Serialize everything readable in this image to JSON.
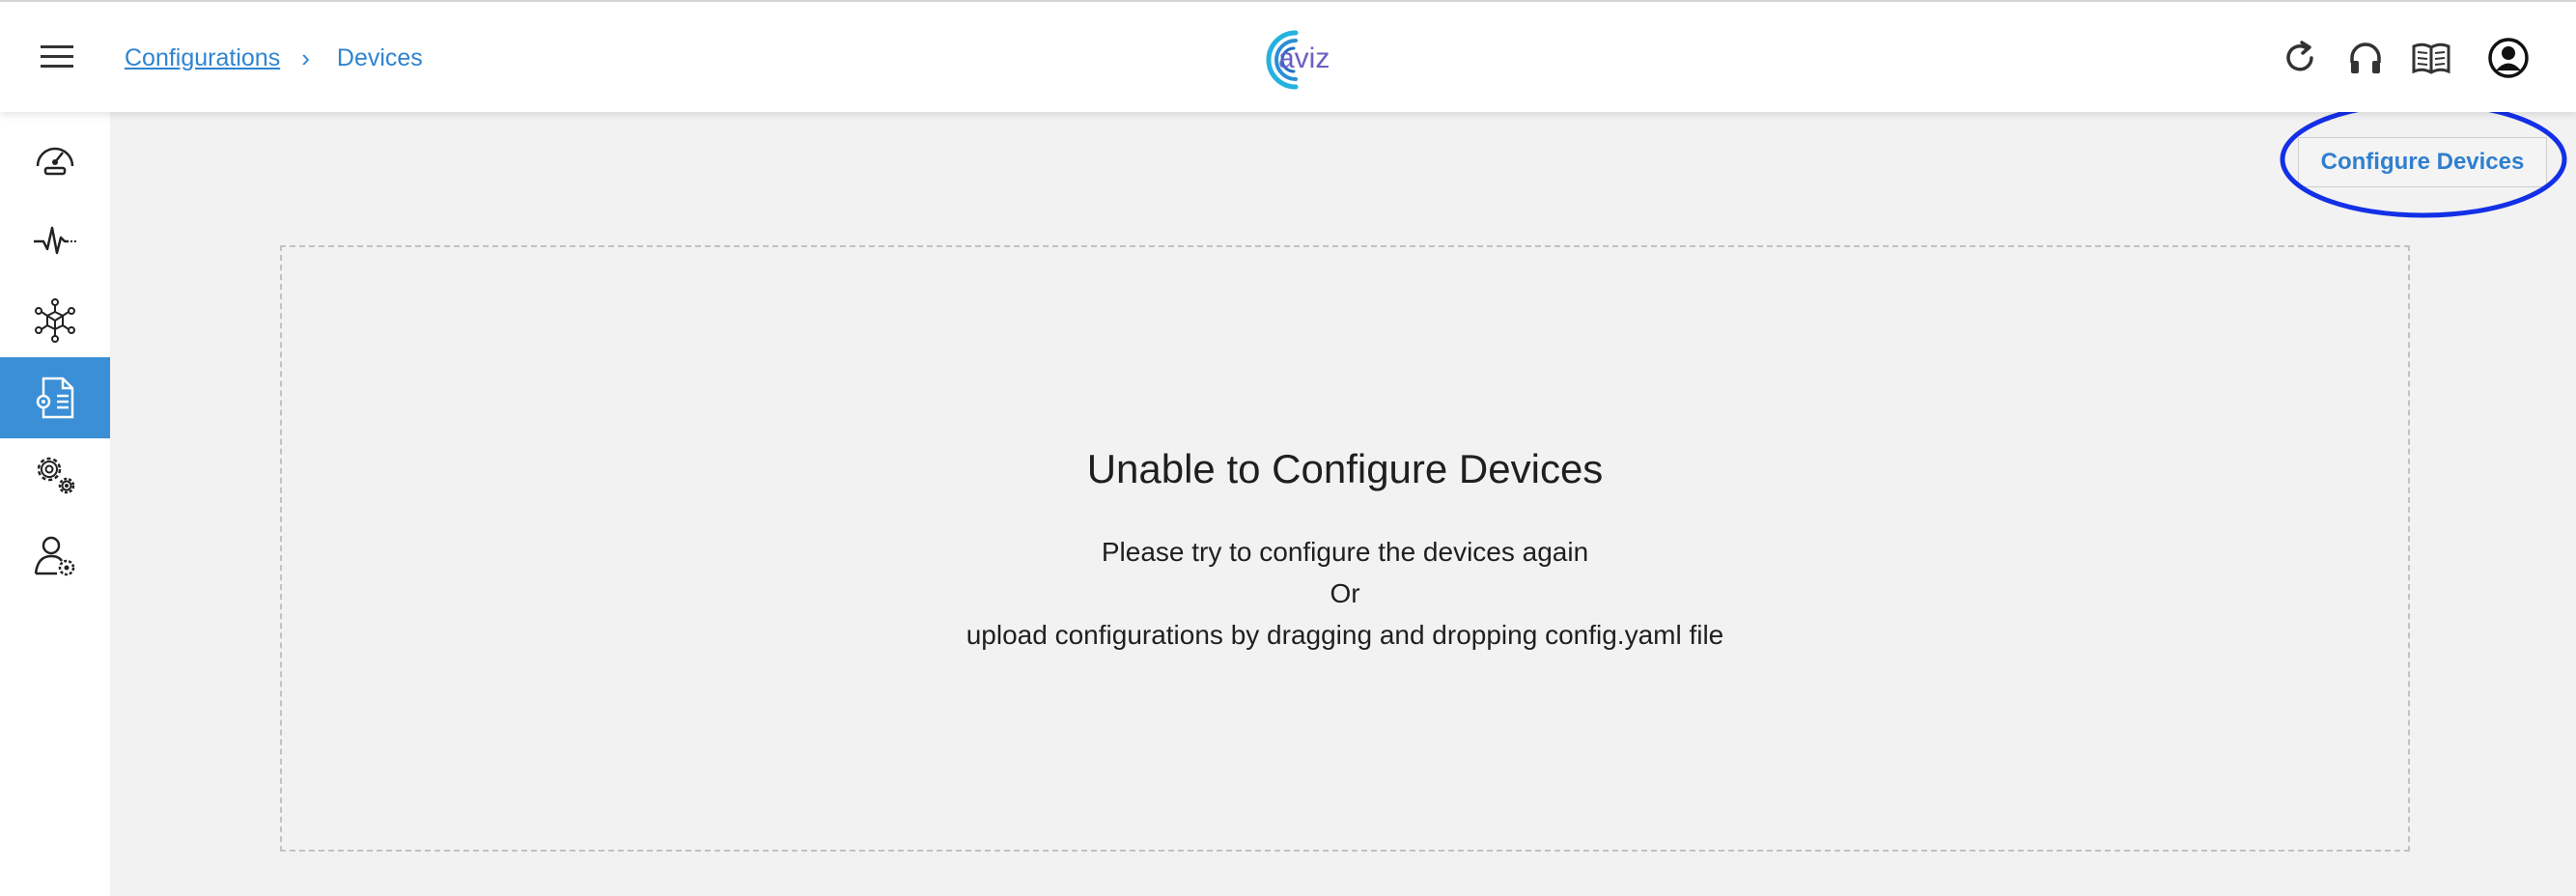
{
  "header": {
    "breadcrumb": [
      {
        "label": "Configurations"
      },
      {
        "label": "Devices"
      }
    ],
    "breadcrumb_separator": "›",
    "logo_text": "aviz",
    "icons": [
      "menu-icon",
      "refresh-icon",
      "headset-icon",
      "book-icon",
      "account-icon"
    ]
  },
  "sidebar": {
    "items": [
      {
        "name": "dashboard",
        "icon": "speedometer-icon",
        "active": false
      },
      {
        "name": "monitoring",
        "icon": "pulse-icon",
        "active": false
      },
      {
        "name": "network",
        "icon": "network-cube-icon",
        "active": false
      },
      {
        "name": "configurations",
        "icon": "config-document-icon",
        "active": true
      },
      {
        "name": "settings",
        "icon": "gears-icon",
        "active": false
      },
      {
        "name": "user-settings",
        "icon": "user-gear-icon",
        "active": false
      }
    ]
  },
  "actions": {
    "configure_devices_label": "Configure Devices"
  },
  "dropzone": {
    "title": "Unable to Configure Devices",
    "line1": "Please try to configure the devices again",
    "line2": "Or",
    "line3": "upload configurations by dragging and dropping config.yaml file"
  },
  "colors": {
    "accent": "#2f84d0",
    "sidebar_active": "#3a8fd6",
    "highlight_ellipse": "#1330e6",
    "background": "#f2f2f2"
  }
}
